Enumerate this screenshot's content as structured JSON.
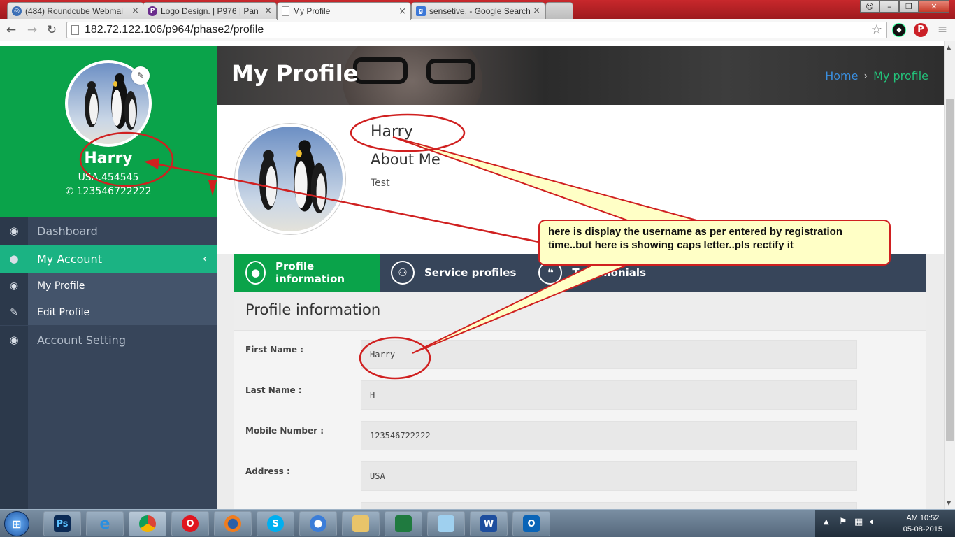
{
  "browser": {
    "tabs": [
      {
        "title": "(484) Roundcube Webmai",
        "active": false
      },
      {
        "title": "Logo Design. | P976 | Pan",
        "active": false
      },
      {
        "title": "My Profile",
        "active": true
      },
      {
        "title": "sensetive. - Google Search",
        "active": false
      },
      {
        "title": "",
        "active": false
      }
    ],
    "url": "182.72.122.106/p964/phase2/profile"
  },
  "sidebar": {
    "name": "Harry",
    "address": "USA,454545",
    "phone": "123546722222",
    "menu": {
      "dashboard": "Dashboard",
      "my_account": "My Account",
      "my_profile": "My Profile",
      "edit_profile": "Edit Profile",
      "account_setting": "Account Setting"
    }
  },
  "header": {
    "title": "My Profile",
    "breadcrumb_home": "Home",
    "breadcrumb_sep": "›",
    "breadcrumb_current": "My profile"
  },
  "profile": {
    "name": "Harry",
    "about_heading": "About Me",
    "about_text": "Test"
  },
  "profile_tabs": [
    {
      "label": "Profile information",
      "active": true
    },
    {
      "label": "Service profiles",
      "active": false
    },
    {
      "label": "Testimonials",
      "active": false
    }
  ],
  "panel": {
    "title": "Profile information",
    "fields": [
      {
        "label": "First Name :",
        "value": "Harry"
      },
      {
        "label": "Last Name :",
        "value": "H"
      },
      {
        "label": "Mobile Number :",
        "value": "123546722222"
      },
      {
        "label": "Address :",
        "value": "USA"
      }
    ]
  },
  "annotation": {
    "note": "here is display the username as per entered by registration time..but here is showing caps letter..pls rectify it",
    "color": "#d02020"
  },
  "taskbar": {
    "time": "AM 10:52",
    "date": "05-08-2015",
    "apps": [
      "Ps",
      "e",
      "chrome",
      "O",
      "firefox",
      "S",
      "safari",
      "folder",
      "excel",
      "word",
      "outlook"
    ]
  },
  "colors": {
    "green": "#0aa34a",
    "sidebar": "#37455a",
    "teal": "#1bb383",
    "link": "#3a8fe0"
  }
}
